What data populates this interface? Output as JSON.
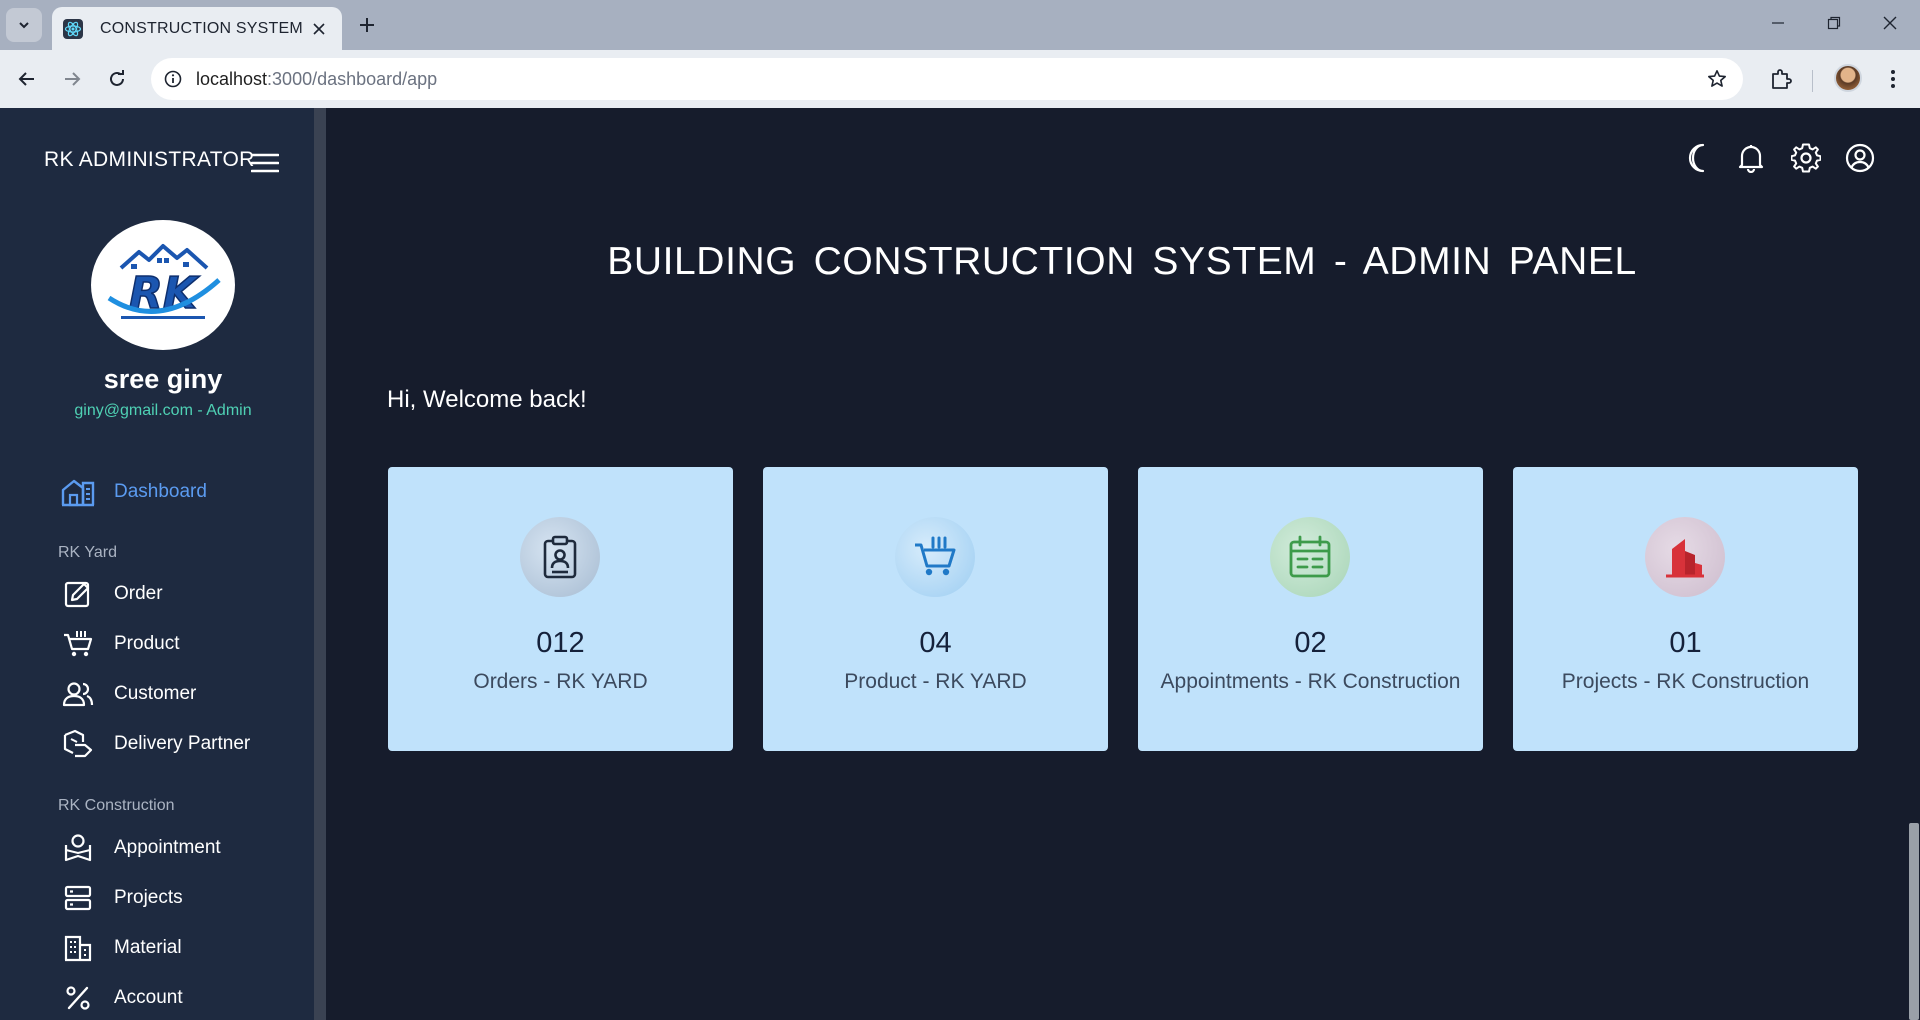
{
  "browser": {
    "tab_title": "CONSTRUCTION SYSTEM",
    "url_host": "localhost",
    "url_rest": ":3000/dashboard/app"
  },
  "sidebar": {
    "brand": "RK ADMINISTRATOR",
    "user_name": "sree giny",
    "user_email": "giny@gmail.com - Admin",
    "dashboard_label": "Dashboard",
    "section_yard": "RK Yard",
    "yard_items": [
      {
        "label": "Order",
        "icon": "order-icon"
      },
      {
        "label": "Product",
        "icon": "cart-icon"
      },
      {
        "label": "Customer",
        "icon": "users-icon"
      },
      {
        "label": "Delivery Partner",
        "icon": "delivery-icon"
      }
    ],
    "section_construction": "RK Construction",
    "construction_items": [
      {
        "label": "Appointment",
        "icon": "appointment-icon"
      },
      {
        "label": "Projects",
        "icon": "projects-icon"
      },
      {
        "label": "Material",
        "icon": "material-icon"
      },
      {
        "label": "Account",
        "icon": "percent-icon"
      }
    ]
  },
  "main": {
    "title": "BUILDING  CONSTRUCTION  SYSTEM  -  ADMIN PANEL",
    "welcome": "Hi, Welcome back!",
    "cards": [
      {
        "value": "012",
        "caption": "Orders - RK YARD",
        "icon": "clipboard-icon",
        "accent": "#1e2a3c"
      },
      {
        "value": "04",
        "caption": "Product - RK YARD",
        "icon": "cart-icon",
        "accent": "#2079c7"
      },
      {
        "value": "02",
        "caption": "Appointments - RK Construction",
        "icon": "calendar-icon",
        "accent": "#3d9b4a"
      },
      {
        "value": "01",
        "caption": "Projects - RK Construction",
        "icon": "building-icon",
        "accent": "#d8323a"
      }
    ]
  },
  "colors": {
    "background": "#161c2c",
    "sidebar": "#1e2a40",
    "card": "#c0e2fb",
    "active_nav": "#5b9bf0",
    "email": "#4fd1b4"
  }
}
